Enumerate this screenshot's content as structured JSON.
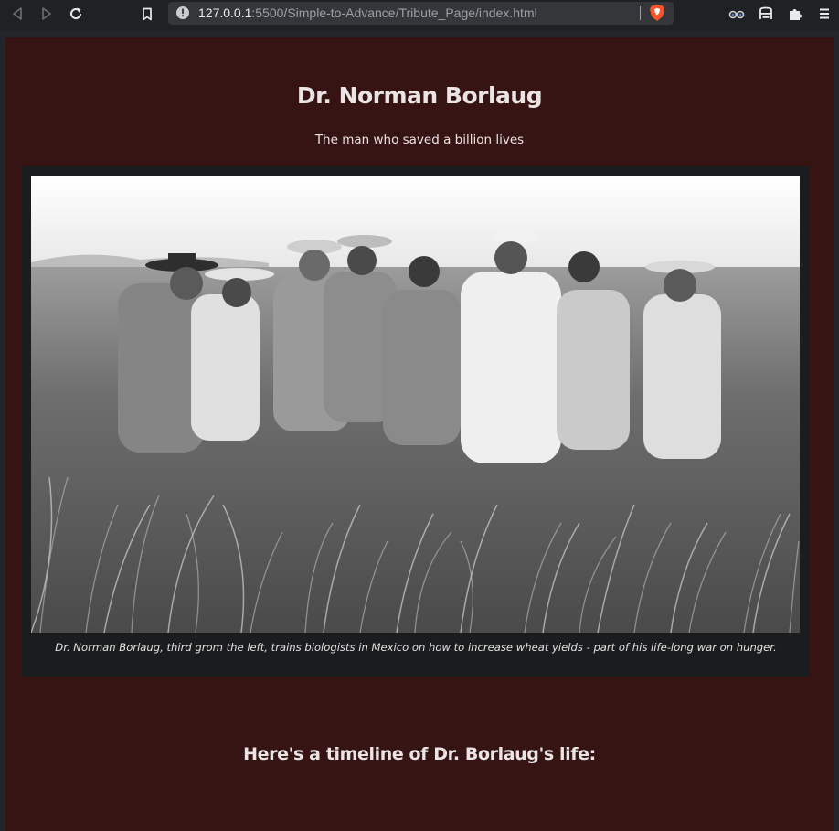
{
  "browser": {
    "url_host": "127.0.0.1",
    "url_path": ":5500/Simple-to-Advance/Tribute_Page/index.html",
    "icons": [
      "back-icon",
      "forward-icon",
      "reload-icon",
      "bookmark-icon",
      "info-icon",
      "brave-shield-icon",
      "profile-icon",
      "reading-list-icon",
      "extensions-icon",
      "menu-icon"
    ]
  },
  "page": {
    "title": "Dr. Norman Borlaug",
    "subtitle": "The man who saved a billion lives",
    "image_caption": "Dr. Norman Borlaug, third grom the left, trains biologists in Mexico on how to increase wheat yields - part of his life-long war on hunger.",
    "timeline_heading": "Here's a timeline of Dr. Borlaug's life:"
  },
  "colors": {
    "page_bg": "#371414",
    "figure_bg": "#1b1c1e",
    "text": "#ebe4e4",
    "chrome_bg": "#202124",
    "url_bg": "#35363a",
    "brave": "#fb542b"
  }
}
